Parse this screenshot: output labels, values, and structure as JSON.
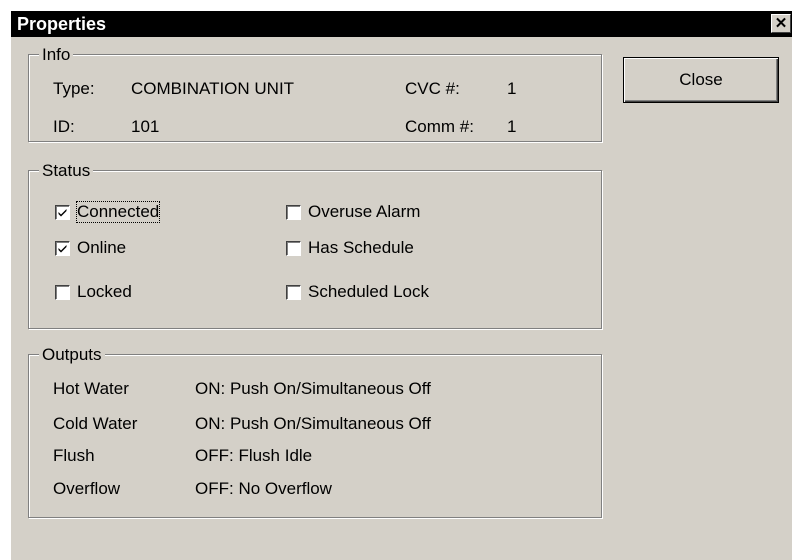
{
  "window": {
    "title": "Properties"
  },
  "close_button": {
    "label": "Close"
  },
  "info": {
    "legend": "Info",
    "type_label": "Type:",
    "type_value": "COMBINATION UNIT",
    "id_label": "ID:",
    "id_value": "101",
    "cvc_label": "CVC #:",
    "cvc_value": "1",
    "comm_label": "Comm #:",
    "comm_value": "1"
  },
  "status": {
    "legend": "Status",
    "items": [
      {
        "label": "Connected",
        "checked": true
      },
      {
        "label": "Online",
        "checked": true
      },
      {
        "label": "Locked",
        "checked": false
      },
      {
        "label": "Overuse Alarm",
        "checked": false
      },
      {
        "label": "Has Schedule",
        "checked": false
      },
      {
        "label": "Scheduled Lock",
        "checked": false
      }
    ]
  },
  "outputs": {
    "legend": "Outputs",
    "rows": [
      {
        "name": "Hot Water",
        "value": "ON: Push On/Simultaneous Off"
      },
      {
        "name": "Cold Water",
        "value": "ON: Push On/Simultaneous Off"
      },
      {
        "name": "Flush",
        "value": "OFF: Flush Idle"
      },
      {
        "name": "Overflow",
        "value": "OFF: No Overflow"
      }
    ]
  }
}
